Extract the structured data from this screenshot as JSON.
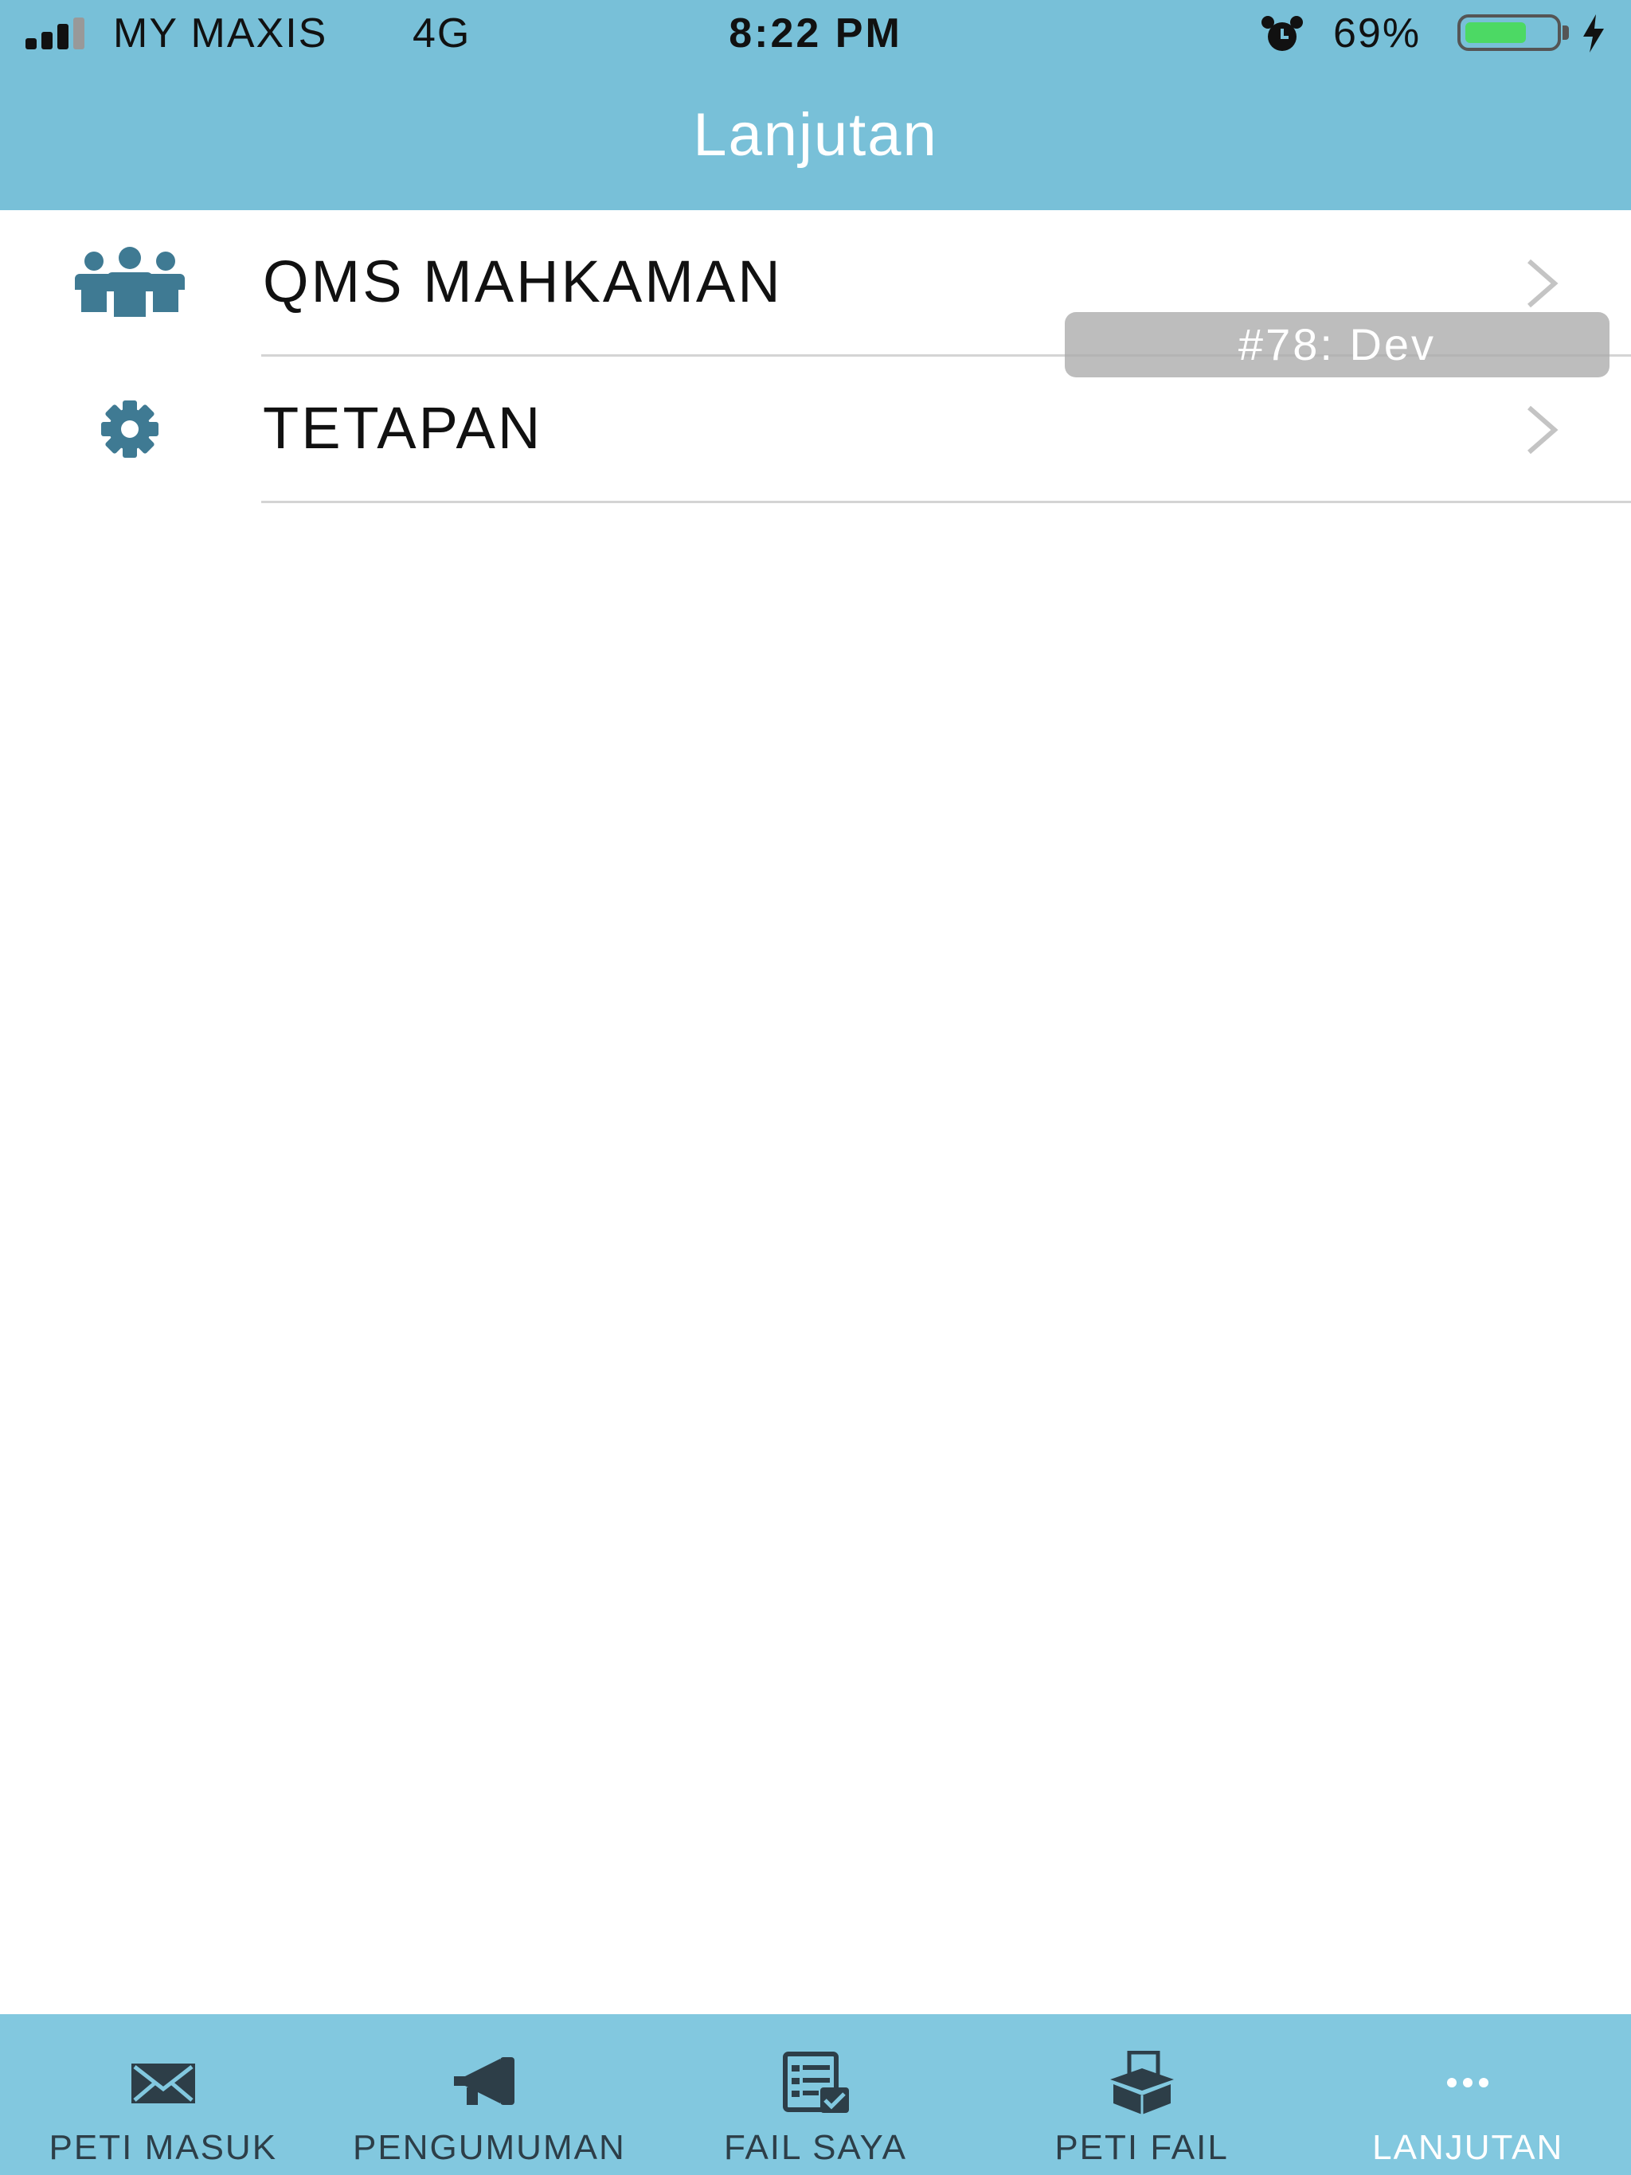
{
  "status_bar": {
    "carrier": "MY MAXIS",
    "network": "4G",
    "time": "8:22 PM",
    "battery_percent": "69%",
    "battery_level": 0.69,
    "signal_bars": 3,
    "icons": [
      "signal-icon",
      "alarm-icon",
      "battery-icon",
      "charging-bolt-icon"
    ]
  },
  "nav": {
    "title": "Lanjutan"
  },
  "menu": {
    "items": [
      {
        "label": "QMS MAHKAMAN",
        "icon": "people-group-icon"
      },
      {
        "label": "TETAPAN",
        "icon": "gear-icon"
      }
    ]
  },
  "overlay_badge": {
    "text": "#78: Dev"
  },
  "tab_bar": {
    "tabs": [
      {
        "label": "PETI MASUK",
        "icon": "envelope-icon",
        "active": false
      },
      {
        "label": "PENGUMUMAN",
        "icon": "megaphone-icon",
        "active": false
      },
      {
        "label": "FAIL SAYA",
        "icon": "checklist-icon",
        "active": false
      },
      {
        "label": "PETI FAIL",
        "icon": "file-box-icon",
        "active": false
      },
      {
        "label": "LANJUTAN",
        "icon": "more-dots-icon",
        "active": true
      }
    ]
  },
  "colors": {
    "header_bg": "#78c0d8",
    "tab_bar_bg": "#82c8df",
    "icon_color": "#3f7a93",
    "tab_icon_color": "#2d3e48",
    "battery_green": "#4cd964"
  }
}
